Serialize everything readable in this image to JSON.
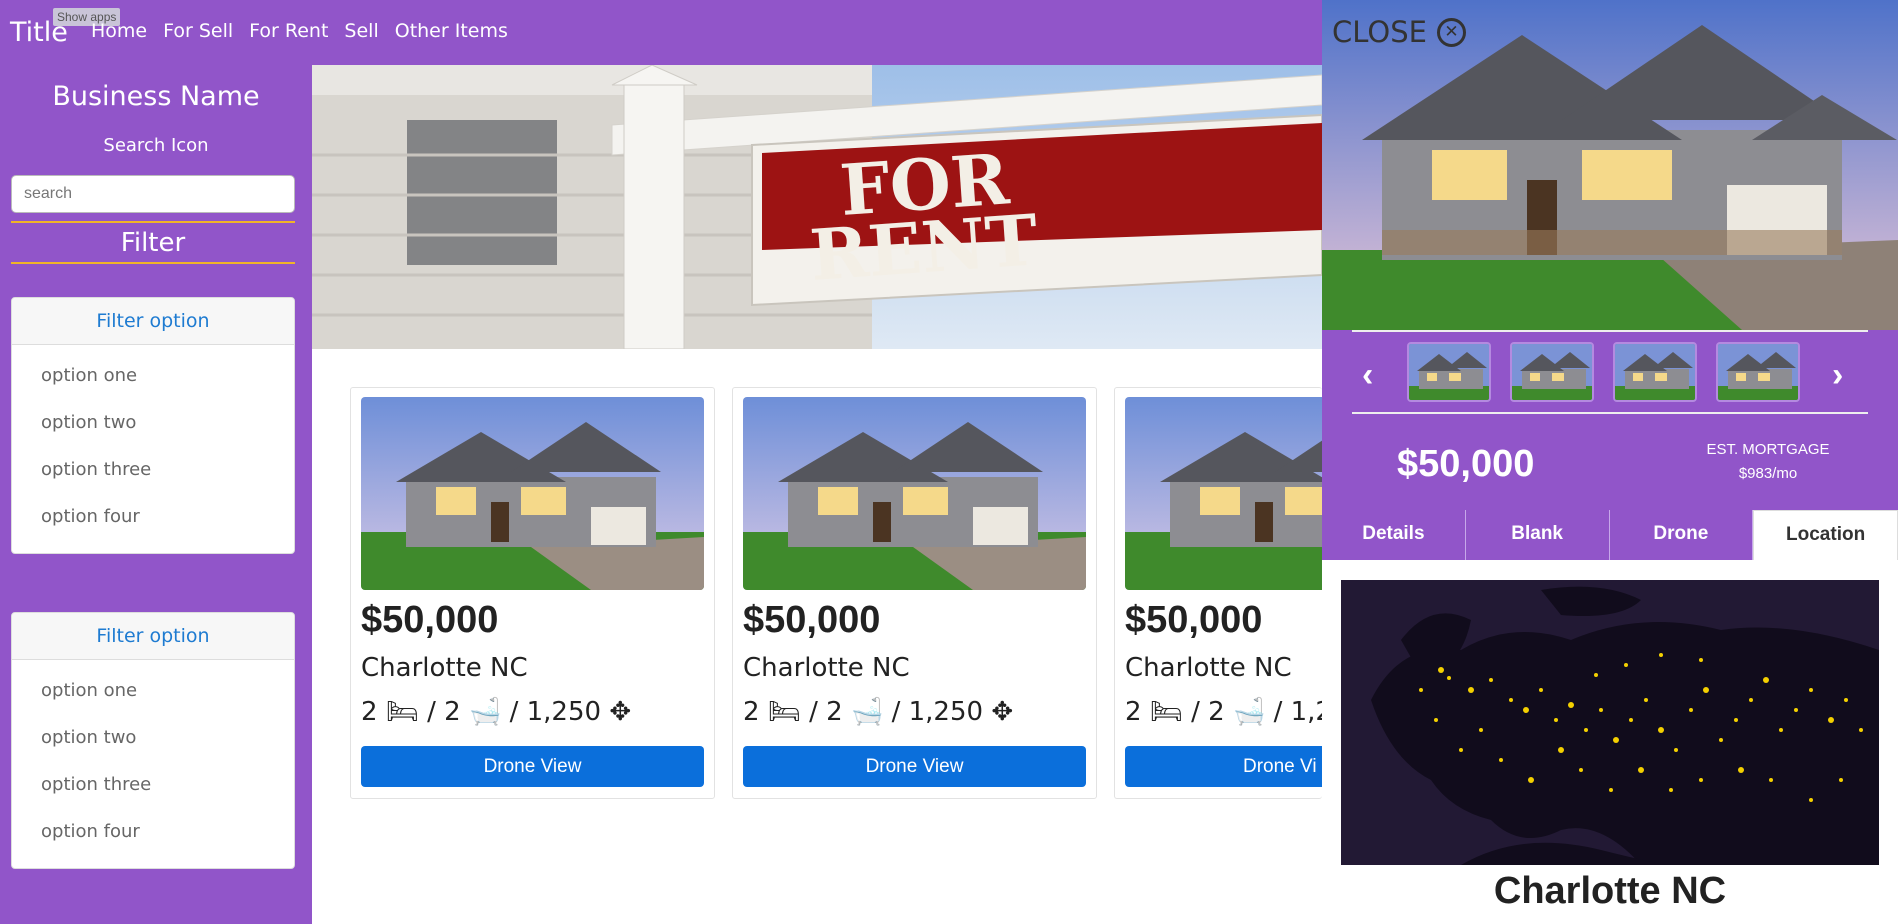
{
  "navbar": {
    "brand": "Title",
    "tooltip": "Show apps",
    "links": [
      "Home",
      "For Sell",
      "For Rent",
      "Sell",
      "Other Items"
    ]
  },
  "sidebar": {
    "business_name": "Business Name",
    "search_label": "Search Icon",
    "search_placeholder": "search",
    "filter_title": "Filter",
    "filter_groups": [
      {
        "title": "Filter option",
        "options": [
          "option one",
          "option two",
          "option three",
          "option four"
        ]
      },
      {
        "title": "Filter option",
        "options": [
          "option one",
          "option two",
          "option three",
          "option four"
        ]
      }
    ]
  },
  "hero": {
    "sign_line1": "FOR",
    "sign_line2": "RENT"
  },
  "listings": [
    {
      "price": "$50,000",
      "city": "Charlotte NC",
      "beds": "2",
      "baths": "2",
      "sqft": "1,250",
      "button": "Drone View"
    },
    {
      "price": "$50,000",
      "city": "Charlotte NC",
      "beds": "2",
      "baths": "2",
      "sqft": "1,250",
      "button": "Drone View"
    },
    {
      "price": "$50,000",
      "city": "Charlotte NC",
      "beds": "2",
      "baths": "2",
      "sqft": "1,2",
      "button": "Drone Vi"
    }
  ],
  "detail": {
    "close_label": "CLOSE",
    "price": "$50,000",
    "mortgage_label": "EST. MORTGAGE",
    "mortgage_value": "$983/mo",
    "tabs": [
      "Details",
      "Blank",
      "Drone",
      "Location"
    ],
    "active_tab": "Location",
    "location": "Charlotte NC"
  },
  "colors": {
    "brand_purple": "#9155c9",
    "accent": "#f0b429",
    "button_blue": "#0b6fdb",
    "link_blue": "#1e7bd1"
  },
  "icons": [
    "bed-icon",
    "bath-icon",
    "move-icon",
    "close-icon",
    "chevron-left-icon",
    "chevron-right-icon"
  ]
}
